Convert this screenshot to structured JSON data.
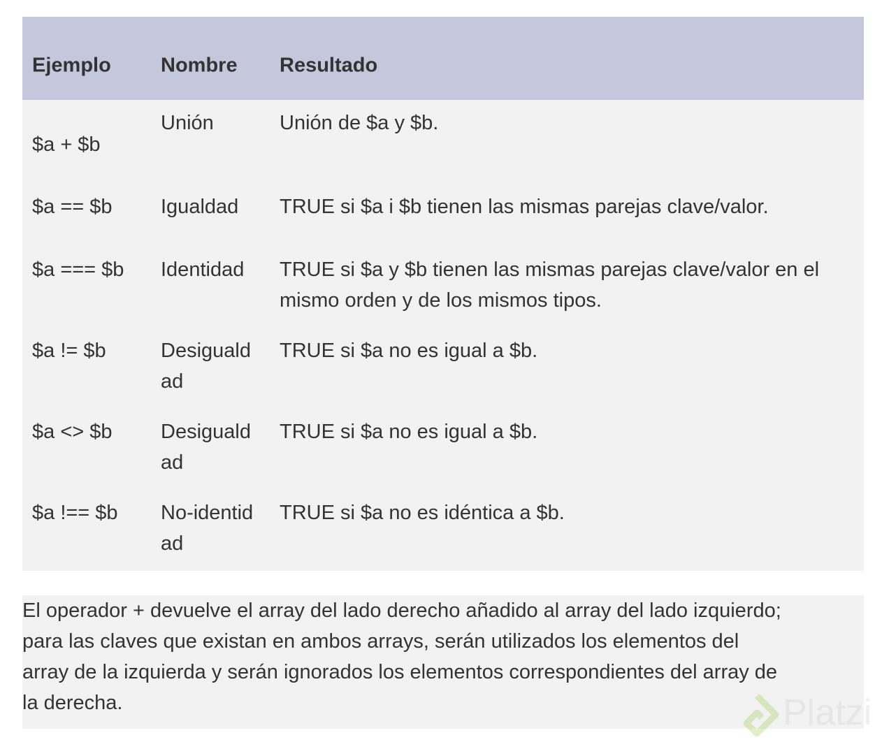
{
  "table": {
    "headers": [
      "Ejemplo",
      "Nombre",
      "Resultado"
    ],
    "rows": [
      {
        "example": "$a + $b",
        "name": "Unión",
        "result": "Unión de $a y $b."
      },
      {
        "example": "$a == $b",
        "name": "Igualdad",
        "result": "TRUE si $a i $b tienen las mismas parejas clave/valor."
      },
      {
        "example": "$a === $b",
        "name": "Identidad",
        "result": "TRUE si $a y $b tienen las mismas parejas clave/valor en el mismo orden y de los mismos tipos."
      },
      {
        "example": "$a != $b",
        "name": "Desigualdad",
        "result": "TRUE si $a no es igual a $b."
      },
      {
        "example": "$a <> $b",
        "name": "Desigualdad",
        "result": "TRUE si $a no es igual a $b."
      },
      {
        "example": "$a !== $b",
        "name": "No-identidad",
        "result": "TRUE si $a no es idéntica a $b."
      }
    ]
  },
  "note": {
    "lines": [
      "El operador + devuelve el array del lado derecho añadido al array del lado izquierdo;",
      "para las claves que existan en ambos arrays, serán utilizados los elementos del",
      "array de la izquierda y serán ignorados los elementos correspondientes del array de",
      "la derecha."
    ]
  },
  "watermark": {
    "text": "Platzi",
    "icon": "platzi-logo-icon",
    "color": "#98ca3f"
  }
}
